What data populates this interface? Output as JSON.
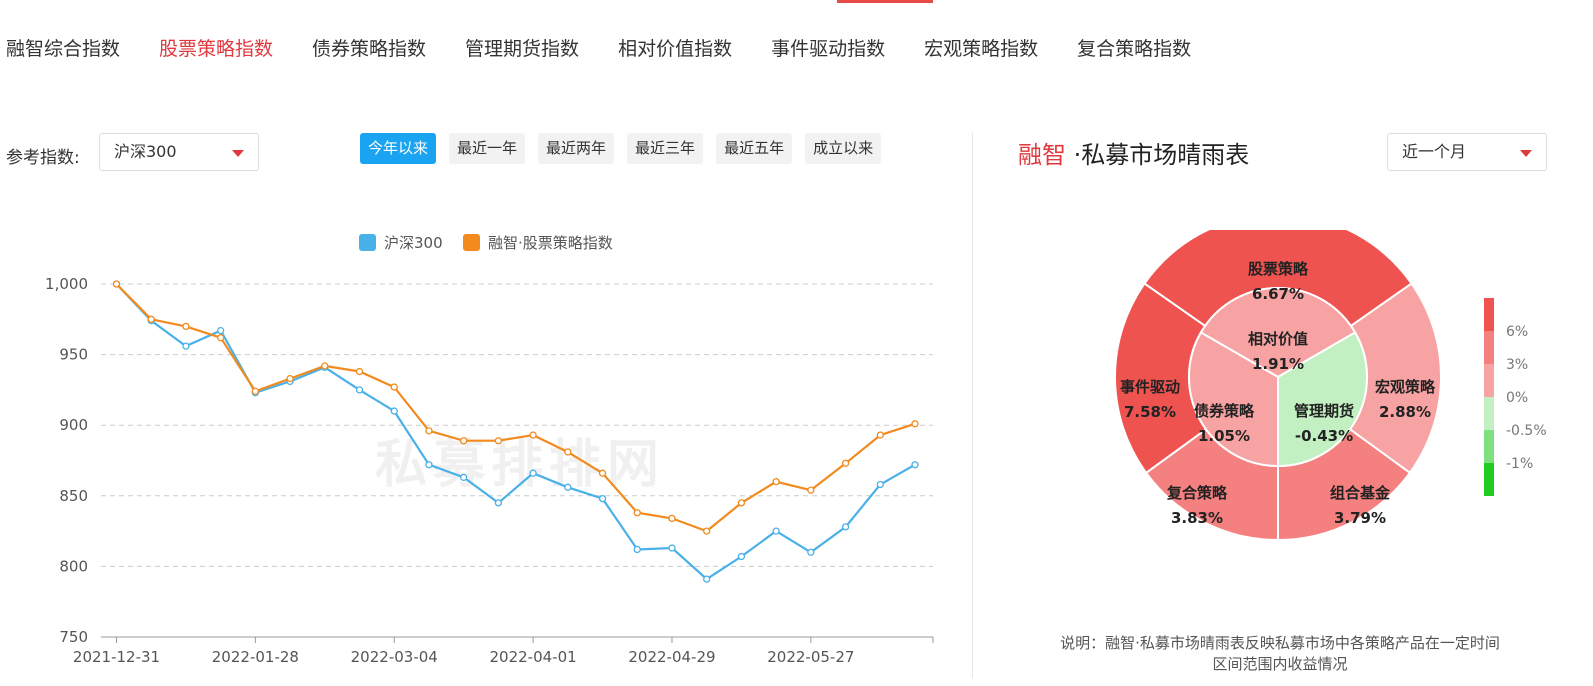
{
  "nav": {
    "tabs": [
      {
        "label": "融智综合指数",
        "active": false
      },
      {
        "label": "股票策略指数",
        "active": true
      },
      {
        "label": "债券策略指数",
        "active": false
      },
      {
        "label": "管理期货指数",
        "active": false
      },
      {
        "label": "相对价值指数",
        "active": false
      },
      {
        "label": "事件驱动指数",
        "active": false
      },
      {
        "label": "宏观策略指数",
        "active": false
      },
      {
        "label": "复合策略指数",
        "active": false
      }
    ]
  },
  "controls": {
    "ref_label": "参考指数:",
    "ref_value": "沪深300",
    "ranges": [
      {
        "label": "今年以来",
        "active": true
      },
      {
        "label": "最近一年",
        "active": false
      },
      {
        "label": "最近两年",
        "active": false
      },
      {
        "label": "最近三年",
        "active": false
      },
      {
        "label": "最近五年",
        "active": false
      },
      {
        "label": "成立以来",
        "active": false
      }
    ]
  },
  "watermark": "私募排排网",
  "colors": {
    "accent": "#e0393e",
    "series_hs300": "#4ab0e8",
    "series_stock": "#f28a1e",
    "active_range": "#1aa3f0"
  },
  "chart_data": [
    {
      "type": "line",
      "legend_position": "top-center",
      "grid": true,
      "ylim": [
        750,
        1000
      ],
      "yticks": [
        "1,000",
        "950",
        "900",
        "850",
        "800",
        "750"
      ],
      "yticks_values": [
        1000,
        950,
        900,
        850,
        800,
        750
      ],
      "xtick_labels": [
        "2021-12-31",
        "2022-01-28",
        "2022-03-04",
        "2022-04-01",
        "2022-04-29",
        "2022-05-27"
      ],
      "xtick_index": [
        0,
        4,
        8,
        12,
        16,
        20
      ],
      "series": [
        {
          "name": "沪深300",
          "values": [
            1000,
            974,
            956,
            967,
            923,
            931,
            941,
            925,
            910,
            872,
            863,
            845,
            866,
            856,
            848,
            812,
            813,
            791,
            807,
            825,
            810,
            828,
            858,
            872
          ]
        },
        {
          "name": "融智·股票策略指数",
          "values": [
            1000,
            975,
            970,
            962,
            924,
            933,
            942,
            938,
            927,
            896,
            889,
            889,
            893,
            881,
            866,
            838,
            834,
            825,
            845,
            860,
            854,
            873,
            893,
            901
          ]
        }
      ]
    },
    {
      "type": "pie",
      "title": {
        "brand": "融智",
        "rest": " ·私募市场晴雨表"
      },
      "period": "近一个月",
      "outer": [
        {
          "name": "股票策略",
          "value": "6.67%"
        },
        {
          "name": "宏观策略",
          "value": "2.88%"
        },
        {
          "name": "组合基金",
          "value": "3.79%"
        },
        {
          "name": "复合策略",
          "value": "3.83%"
        },
        {
          "name": "事件驱动",
          "value": "7.58%"
        }
      ],
      "inner": [
        {
          "name": "相对价值",
          "value": "1.91%"
        },
        {
          "name": "管理期货",
          "value": "-0.43%"
        },
        {
          "name": "债券策略",
          "value": "1.05%"
        }
      ],
      "scale": [
        "6%",
        "3%",
        "0%",
        "-0.5%",
        "-1%"
      ],
      "note": "说明：融智·私募市场晴雨表反映私募市场中各策略产品在一定时间区间范围内收益情况"
    }
  ]
}
